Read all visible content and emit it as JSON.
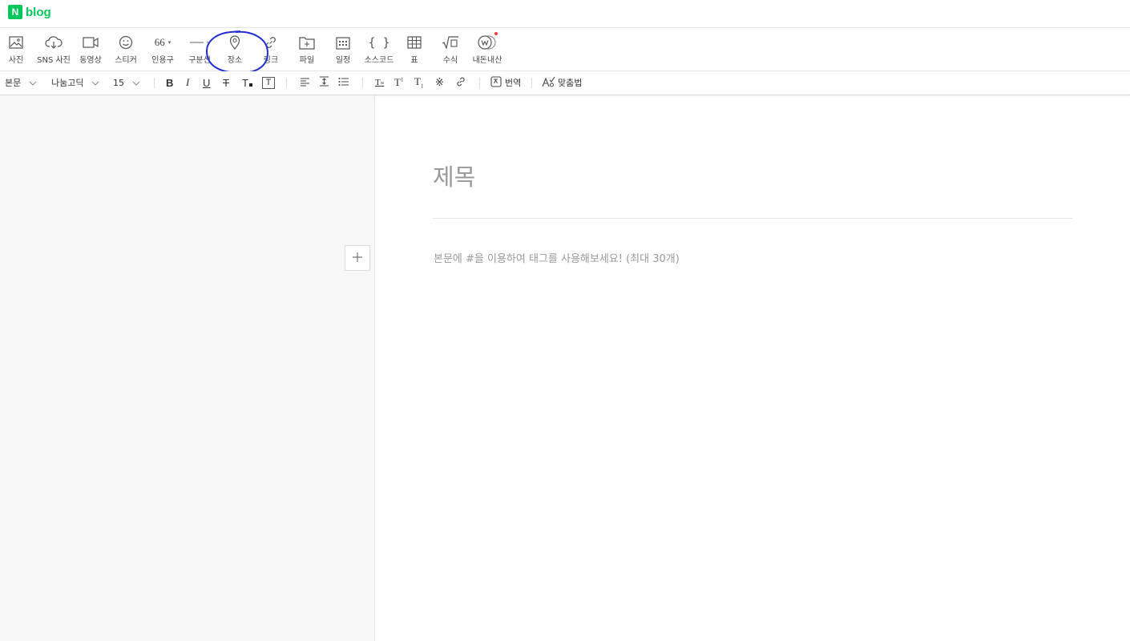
{
  "brand": {
    "mark": "N",
    "name": "blog"
  },
  "insert_tools": [
    {
      "label": "사진",
      "icon": "image-icon"
    },
    {
      "label": "SNS 사진",
      "icon": "cloud-download-icon"
    },
    {
      "label": "동영상",
      "icon": "video-icon"
    },
    {
      "label": "스티커",
      "icon": "smiley-icon"
    },
    {
      "label": "인용구",
      "icon": "quote-icon"
    },
    {
      "label": "구분선",
      "icon": "divider-icon"
    },
    {
      "label": "장소",
      "icon": "map-pin-icon"
    },
    {
      "label": "링크",
      "icon": "link-icon"
    },
    {
      "label": "파일",
      "icon": "file-add-icon"
    },
    {
      "label": "일정",
      "icon": "calendar-icon"
    },
    {
      "label": "소스코드",
      "icon": "code-braces-icon"
    },
    {
      "label": "표",
      "icon": "table-icon"
    },
    {
      "label": "수식",
      "icon": "formula-icon"
    },
    {
      "label": "내돈내산",
      "icon": "badge-w-icon"
    }
  ],
  "quote_glyph": "66",
  "format": {
    "paragraph_style": "본문",
    "font": "나눔고딕",
    "size": "15",
    "translate": "번역",
    "spellcheck": "맞춤법"
  },
  "editor": {
    "title_placeholder": "제목",
    "body_placeholder": "본문에 #을 이용하여 태그를 사용해보세요! (최대 30개)"
  },
  "colors": {
    "brand": "#03c75a",
    "annotation": "#1f2fd1",
    "new_dot": "#ff3b3b"
  }
}
